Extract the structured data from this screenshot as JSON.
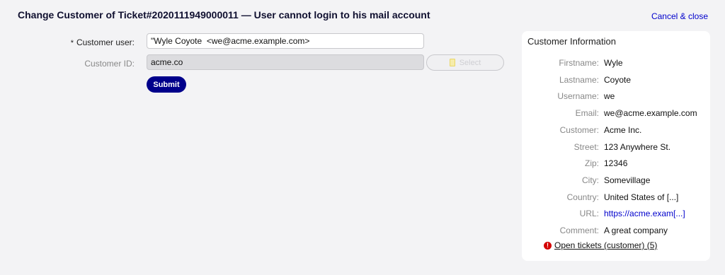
{
  "header": {
    "title": "Change Customer of Ticket#2020111949000011 — User cannot login to his mail account",
    "cancel_label": "Cancel & close"
  },
  "form": {
    "customer_user": {
      "required_marker": "*",
      "label": "Customer user:",
      "value": "\"Wyle Coyote  <we@acme.example.com>"
    },
    "customer_id": {
      "label": "Customer ID:",
      "value": "acme.co"
    },
    "select_label": "Select",
    "submit_label": "Submit"
  },
  "customer_info": {
    "title": "Customer Information",
    "fields": [
      {
        "label": "Firstname:",
        "value": "Wyle"
      },
      {
        "label": "Lastname:",
        "value": "Coyote"
      },
      {
        "label": "Username:",
        "value": "we"
      },
      {
        "label": "Email:",
        "value": "we@acme.example.com"
      },
      {
        "label": "Customer:",
        "value": "Acme Inc."
      },
      {
        "label": "Street:",
        "value": "123 Anywhere St."
      },
      {
        "label": "Zip:",
        "value": "12346"
      },
      {
        "label": "City:",
        "value": "Somevillage"
      },
      {
        "label": "Country:",
        "value": "United States of [...]"
      },
      {
        "label": "URL:",
        "value": "https://acme.exam[...]"
      },
      {
        "label": "Comment:",
        "value": "A great company"
      }
    ],
    "open_tickets_label": "Open tickets (customer) (5)",
    "alert_icon": "exclamation-circle-icon",
    "alert_color": "#d40000"
  },
  "colors": {
    "accent": "#00008b",
    "link": "#0000cc",
    "background": "#f3f3f5"
  }
}
